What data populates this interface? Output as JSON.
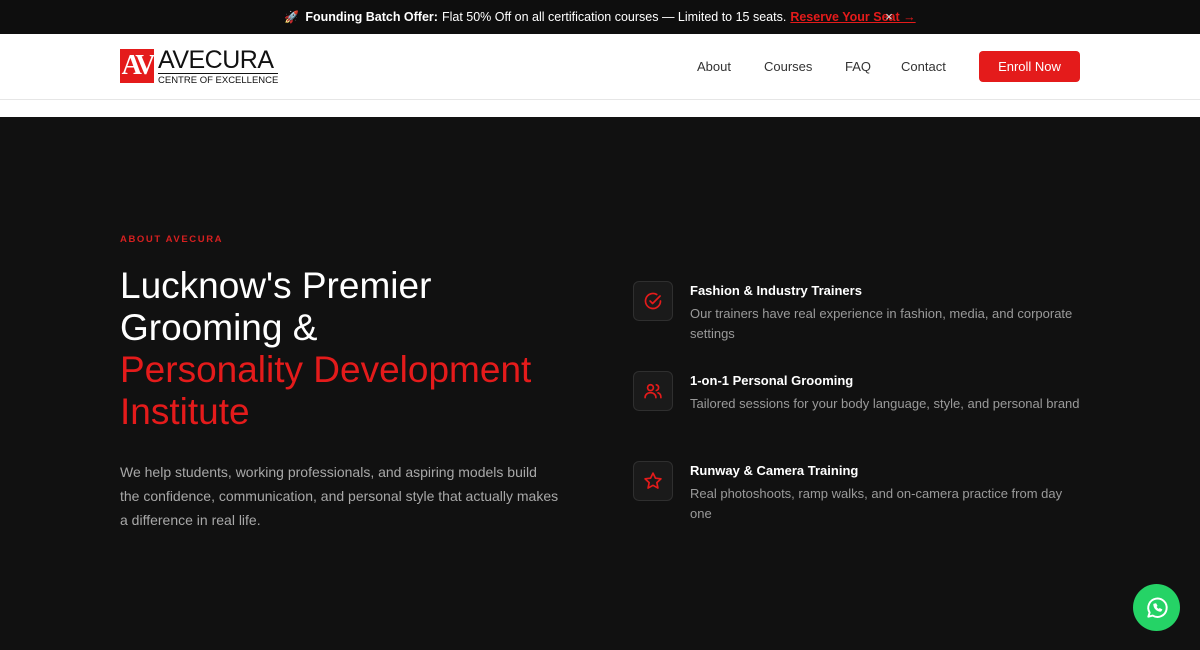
{
  "announcement": {
    "icon": "rocket-icon",
    "lead": "Founding Batch Offer:",
    "text": "Flat 50% Off on all certification courses — Limited to 15 seats.",
    "link": "Reserve Your Seat →",
    "close": "×"
  },
  "brand": {
    "mark": "AV",
    "name": "AVECURA",
    "tagline": "CENTRE OF EXCELLENCE",
    "accent": "#e41b1b"
  },
  "nav": {
    "items": [
      "About",
      "Courses",
      "FAQ",
      "Contact"
    ],
    "cta": "Enroll Now"
  },
  "hero": {
    "eyebrow": "ABOUT AVECURA",
    "title_white": "Lucknow's Premier Grooming &",
    "title_red": "Personality Development Institute",
    "description": "We help students, working professionals, and aspiring models build the confidence, communication, and personal style that actually makes a difference in real life."
  },
  "features": [
    {
      "icon": "check-badge-icon",
      "title": "Fashion & Industry Trainers",
      "description": "Our trainers have real experience in fashion, media, and corporate settings"
    },
    {
      "icon": "users-icon",
      "title": "1-on-1 Personal Grooming",
      "description": "Tailored sessions for your body language, style, and personal brand"
    },
    {
      "icon": "star-icon",
      "title": "Runway & Camera Training",
      "description": "Real photoshoots, ramp walks, and on-camera practice from day one"
    }
  ],
  "whatsapp": {
    "icon": "whatsapp-icon",
    "color": "#25d366"
  }
}
